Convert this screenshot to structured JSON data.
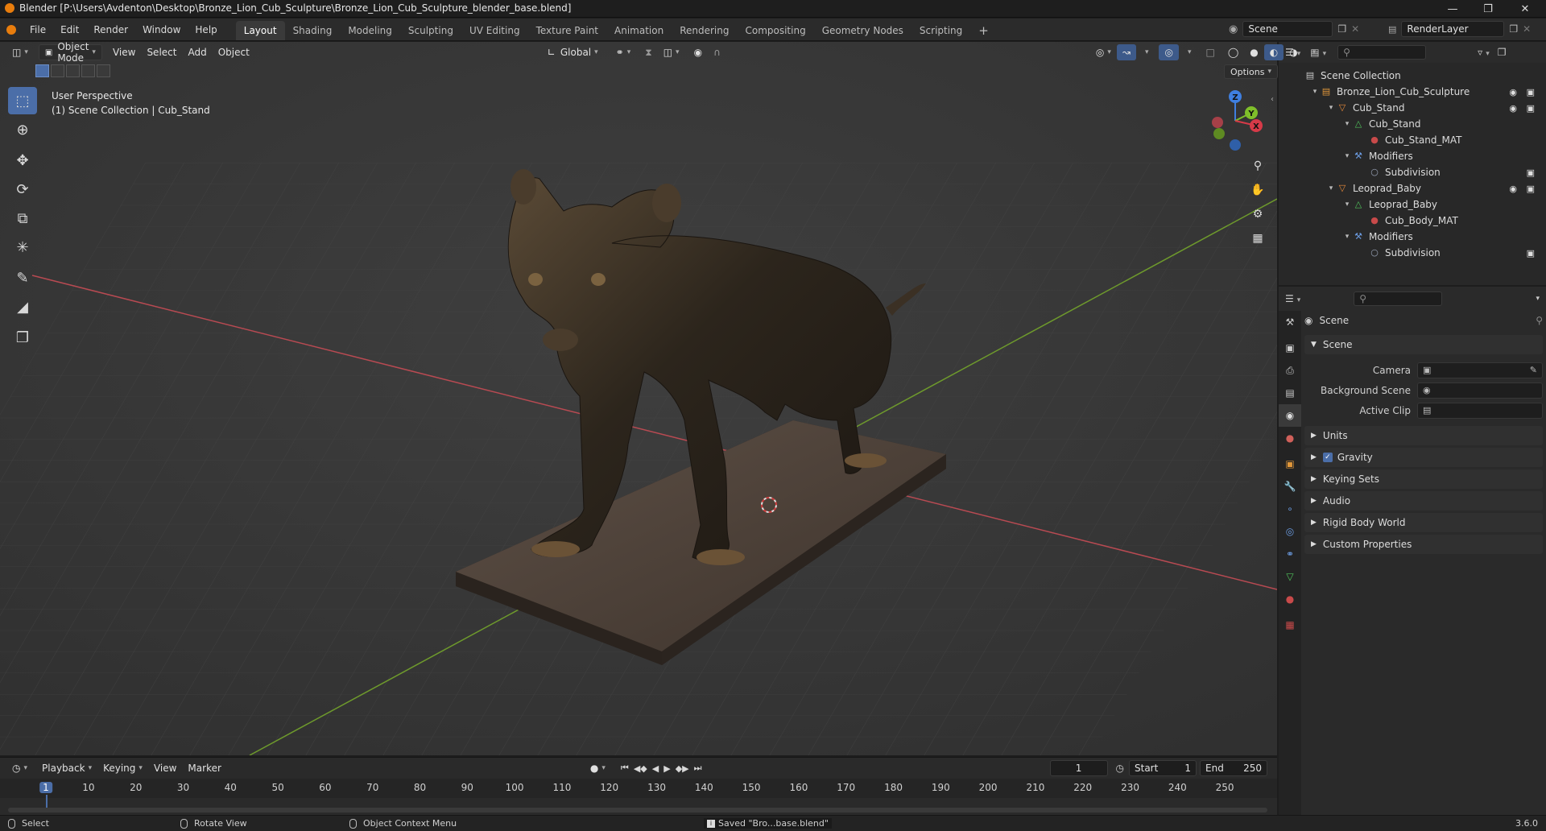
{
  "app": {
    "title": "Blender [P:\\Users\\Avdenton\\Desktop\\Bronze_Lion_Cub_Sculpture\\Bronze_Lion_Cub_Sculpture_blender_base.blend]",
    "version": "3.6.0"
  },
  "menu": [
    "File",
    "Edit",
    "Render",
    "Window",
    "Help"
  ],
  "workspaces": [
    {
      "label": "Layout",
      "active": true
    },
    {
      "label": "Shading"
    },
    {
      "label": "Modeling"
    },
    {
      "label": "Sculpting"
    },
    {
      "label": "UV Editing"
    },
    {
      "label": "Texture Paint"
    },
    {
      "label": "Animation"
    },
    {
      "label": "Rendering"
    },
    {
      "label": "Compositing"
    },
    {
      "label": "Geometry Nodes"
    },
    {
      "label": "Scripting"
    }
  ],
  "scene_selector": "Scene",
  "view_layer": "RenderLayer",
  "viewport": {
    "mode": "Object Mode",
    "menus": [
      "View",
      "Select",
      "Add",
      "Object"
    ],
    "transform_orientation": "Global",
    "options_label": "Options",
    "perspective": "User Perspective",
    "context": "(1) Scene Collection | Cub_Stand",
    "gizmo_axes": {
      "z": "Z",
      "y": "Y",
      "x": "X"
    }
  },
  "outliner": {
    "rows": [
      {
        "label": "Scene Collection",
        "icon": "collection-icon",
        "depth": 0,
        "color": "#c8c8c8"
      },
      {
        "label": "Bronze_Lion_Cub_Sculpture",
        "icon": "collection-icon",
        "depth": 1,
        "color": "#e0973a",
        "vis": true
      },
      {
        "label": "Cub_Stand",
        "icon": "object-icon",
        "depth": 2,
        "color": "#e88a3a",
        "vis": true
      },
      {
        "label": "Cub_Stand",
        "icon": "mesh-icon",
        "depth": 3,
        "color": "#4fc25a"
      },
      {
        "label": "Cub_Stand_MAT",
        "icon": "material-icon",
        "depth": 4,
        "color": "#c84a4a"
      },
      {
        "label": "Modifiers",
        "icon": "wrench-icon",
        "depth": 3,
        "color": "#6b9be0"
      },
      {
        "label": "Subdivision",
        "icon": "subdivision-icon",
        "depth": 4,
        "color": "#9aa4b8",
        "cam": true
      },
      {
        "label": "Leoprad_Baby",
        "icon": "object-icon",
        "depth": 2,
        "color": "#e88a3a",
        "vis": true
      },
      {
        "label": "Leoprad_Baby",
        "icon": "mesh-icon",
        "depth": 3,
        "color": "#4fc25a"
      },
      {
        "label": "Cub_Body_MAT",
        "icon": "material-icon",
        "depth": 4,
        "color": "#c84a4a"
      },
      {
        "label": "Modifiers",
        "icon": "wrench-icon",
        "depth": 3,
        "color": "#6b9be0"
      },
      {
        "label": "Subdivision",
        "icon": "subdivision-icon",
        "depth": 4,
        "color": "#9aa4b8",
        "cam": true
      }
    ]
  },
  "properties": {
    "context_title": "Scene",
    "section_scene": "Scene",
    "fields": [
      {
        "label": "Camera"
      },
      {
        "label": "Background Scene"
      },
      {
        "label": "Active Clip"
      }
    ],
    "panels": [
      "Units",
      "Gravity",
      "Keying Sets",
      "Audio",
      "Rigid Body World",
      "Custom Properties"
    ],
    "gravity_checked": true
  },
  "timeline": {
    "menus": [
      "Playback",
      "Keying",
      "View",
      "Marker"
    ],
    "current_frame": "1",
    "start_label": "Start",
    "start": "1",
    "end_label": "End",
    "end": "250",
    "ticks": [
      "1",
      "10",
      "20",
      "30",
      "40",
      "50",
      "60",
      "70",
      "80",
      "90",
      "100",
      "110",
      "120",
      "130",
      "140",
      "150",
      "160",
      "170",
      "180",
      "190",
      "200",
      "210",
      "220",
      "230",
      "240",
      "250"
    ]
  },
  "status": {
    "select": "Select",
    "rotate": "Rotate View",
    "context_menu": "Object Context Menu",
    "message": "Saved \"Bro...base.blend\""
  },
  "colors": {
    "accent": "#4b6ea8",
    "x_axis": "#d63a48",
    "y_axis": "#7fbf2a",
    "z_axis": "#3f7fe0"
  }
}
